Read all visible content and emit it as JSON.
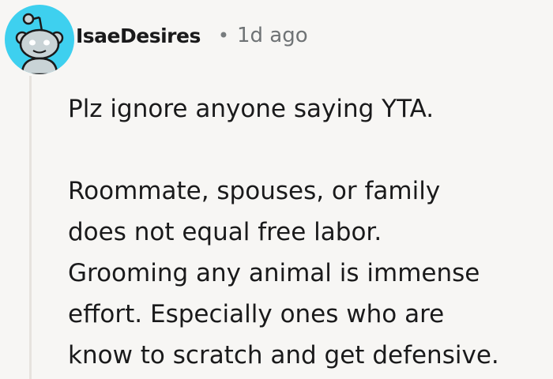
{
  "comment": {
    "author": "IsaeDesires",
    "separator": "•",
    "timestamp": "1d ago",
    "avatar_icon": "reddit-snoo-avatar-icon",
    "avatar_color": "#3ed0ef",
    "paragraph_1": "Plz ignore anyone saying YTA.",
    "paragraph_2_lines": [
      "Roommate, spouses, or family",
      "does not equal free labor.",
      "Grooming any animal is immense",
      "effort. Especially ones who are",
      "know to scratch and get defensive."
    ]
  }
}
